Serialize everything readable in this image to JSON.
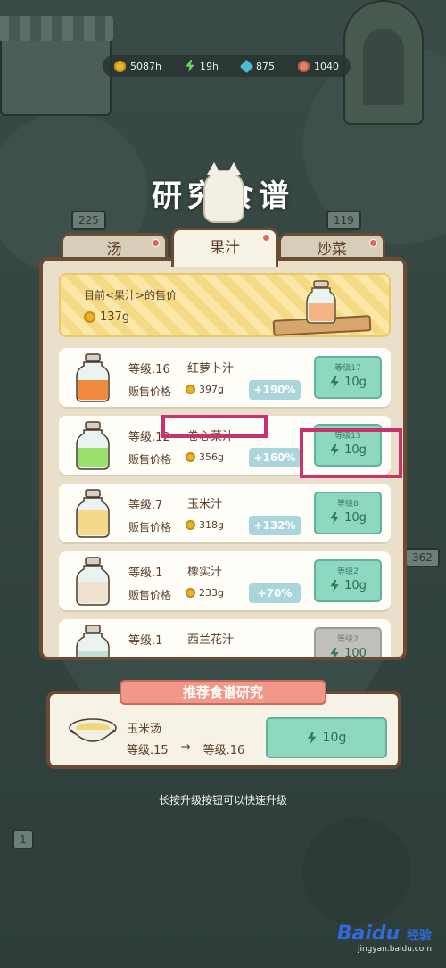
{
  "resources": [
    {
      "icon": "coin-icon",
      "value": "5087h"
    },
    {
      "icon": "energy-icon",
      "value": "19h"
    },
    {
      "icon": "gem-icon",
      "value": "875"
    },
    {
      "icon": "shell-icon",
      "value": "1040"
    }
  ],
  "background_signs": [
    "225",
    "119",
    "362",
    "1"
  ],
  "title": "研究食谱",
  "tabs": [
    {
      "label": "汤",
      "badge": true
    },
    {
      "label": "果汁",
      "badge": true,
      "active": true
    },
    {
      "label": "炒菜",
      "badge": true
    }
  ],
  "price_banner": {
    "label": "目前<果汁>的售价",
    "value": "137g"
  },
  "sale_price_label": "贩售价格",
  "recipes": [
    {
      "level": "等级.16",
      "name": "红萝卜汁",
      "price": "397g",
      "bonus": "+190%",
      "next": "等级17",
      "cost": "10g",
      "juice": "#f08a3a",
      "locked": false
    },
    {
      "level": "等级.12",
      "name": "卷心菜汁",
      "price": "356g",
      "bonus": "+160%",
      "next": "等级13",
      "cost": "10g",
      "juice": "#9be06a",
      "locked": false
    },
    {
      "level": "等级.7",
      "name": "玉米汁",
      "price": "318g",
      "bonus": "+132%",
      "next": "等级8",
      "cost": "10g",
      "juice": "#f4d98a",
      "locked": false
    },
    {
      "level": "等级.1",
      "name": "橡实汁",
      "price": "233g",
      "bonus": "+70%",
      "next": "等级2",
      "cost": "10g",
      "juice": "#efe3cf",
      "locked": false
    },
    {
      "level": "等级.1",
      "name": "西兰花汁",
      "price": "",
      "bonus": "",
      "next": "等级2",
      "cost": "100",
      "juice": "#bfe2d0",
      "locked": true
    }
  ],
  "recommend": {
    "header": "推荐食谱研究",
    "name": "玉米汤",
    "from_level": "等级.15",
    "arrow": "→",
    "to_level": "等级.16",
    "cost": "10g"
  },
  "hint": "长按升级按钮可以快速升级",
  "watermark": {
    "logo_a": "Bai",
    "logo_b": "du",
    "logo_c": "经验",
    "url": "jingyan.baidu.com"
  },
  "colors": {
    "highlight": "#c8336e",
    "upgrade_button": "#8ed8c1",
    "panel_border": "#6b4b33"
  }
}
